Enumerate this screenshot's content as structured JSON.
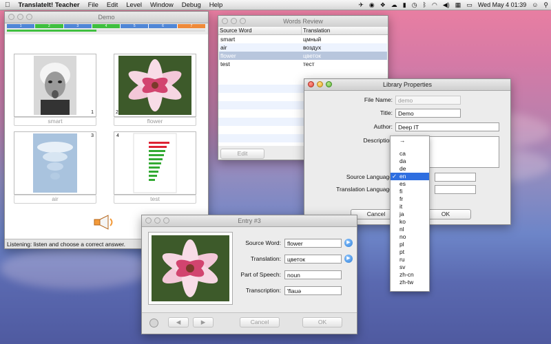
{
  "menubar": {
    "app_name": "TranslateIt! Teacher",
    "items": [
      "File",
      "Edit",
      "Level",
      "Window",
      "Debug",
      "Help"
    ],
    "clock": "Wed May 4  01:39"
  },
  "demo": {
    "title": "Demo",
    "progress_segments": [
      "1",
      "2",
      "3",
      "4",
      "5",
      "6",
      "7"
    ],
    "progress_value": 0.45,
    "cards": [
      {
        "number": "1",
        "caption": "smart"
      },
      {
        "number": "2",
        "caption": "flower"
      },
      {
        "number": "3",
        "caption": "air"
      },
      {
        "number": "4",
        "caption": "test"
      }
    ],
    "status": "Listening: listen and choose a correct answer."
  },
  "words_review": {
    "title": "Words Review",
    "headers": [
      "Source Word",
      "Translation"
    ],
    "rows": [
      {
        "source": "smart",
        "translation": "цмный"
      },
      {
        "source": "air",
        "translation": "воздух"
      },
      {
        "source": "flower",
        "translation": "цветок"
      },
      {
        "source": "test",
        "translation": "тест"
      }
    ],
    "selected_row": 2,
    "edit_label": "Edit"
  },
  "library": {
    "title": "Library Properties",
    "file_name_label": "File Name:",
    "file_name": "demo",
    "title_label": "Title:",
    "title_value": "Demo",
    "author_label": "Author:",
    "author_value": "Deep IT",
    "description_label": "Description",
    "source_language_label": "Source Language",
    "translation_language_label": "Translation Language",
    "cancel_label": "Cancel",
    "ok_label": "OK"
  },
  "language_dropdown": {
    "arrow": "→",
    "options": [
      "ca",
      "da",
      "de",
      "en",
      "es",
      "fi",
      "fr",
      "it",
      "ja",
      "ko",
      "nl",
      "no",
      "pl",
      "pt",
      "ru",
      "sv",
      "zh-cn",
      "zh-tw"
    ],
    "selected": "en"
  },
  "entry": {
    "title": "Entry #3",
    "source_word_label": "Source Word:",
    "source_word": "flower",
    "translation_label": "Translation:",
    "translation": "цветок",
    "pos_label": "Part of Speech:",
    "pos": "noun",
    "transcription_label": "Transcription:",
    "transcription": "'flauə",
    "prev_label": "◀",
    "next_label": "▶",
    "cancel_label": "Cancel",
    "ok_label": "OK"
  },
  "colors": {
    "segment_blue": "#4f86d6",
    "segment_green": "#3fbf3f",
    "segment_orange": "#ef8a3a",
    "selection": "#2f6fe0"
  }
}
